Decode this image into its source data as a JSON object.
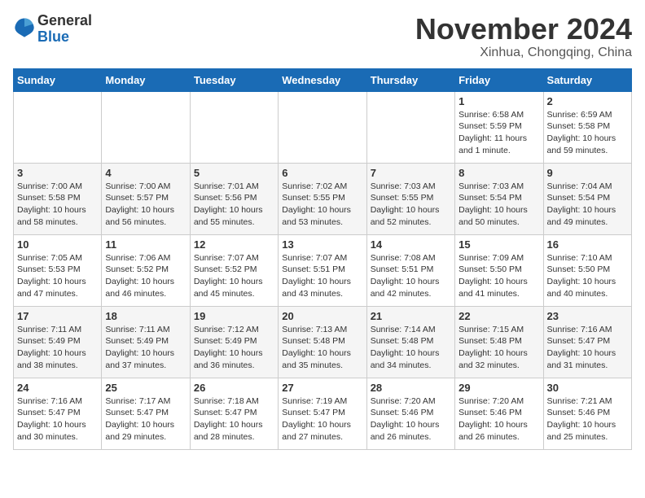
{
  "header": {
    "logo_line1": "General",
    "logo_line2": "Blue",
    "month_title": "November 2024",
    "location": "Xinhua, Chongqing, China"
  },
  "days_of_week": [
    "Sunday",
    "Monday",
    "Tuesday",
    "Wednesday",
    "Thursday",
    "Friday",
    "Saturday"
  ],
  "weeks": [
    [
      {
        "day": "",
        "info": ""
      },
      {
        "day": "",
        "info": ""
      },
      {
        "day": "",
        "info": ""
      },
      {
        "day": "",
        "info": ""
      },
      {
        "day": "",
        "info": ""
      },
      {
        "day": "1",
        "info": "Sunrise: 6:58 AM\nSunset: 5:59 PM\nDaylight: 11 hours and 1 minute."
      },
      {
        "day": "2",
        "info": "Sunrise: 6:59 AM\nSunset: 5:58 PM\nDaylight: 10 hours and 59 minutes."
      }
    ],
    [
      {
        "day": "3",
        "info": "Sunrise: 7:00 AM\nSunset: 5:58 PM\nDaylight: 10 hours and 58 minutes."
      },
      {
        "day": "4",
        "info": "Sunrise: 7:00 AM\nSunset: 5:57 PM\nDaylight: 10 hours and 56 minutes."
      },
      {
        "day": "5",
        "info": "Sunrise: 7:01 AM\nSunset: 5:56 PM\nDaylight: 10 hours and 55 minutes."
      },
      {
        "day": "6",
        "info": "Sunrise: 7:02 AM\nSunset: 5:55 PM\nDaylight: 10 hours and 53 minutes."
      },
      {
        "day": "7",
        "info": "Sunrise: 7:03 AM\nSunset: 5:55 PM\nDaylight: 10 hours and 52 minutes."
      },
      {
        "day": "8",
        "info": "Sunrise: 7:03 AM\nSunset: 5:54 PM\nDaylight: 10 hours and 50 minutes."
      },
      {
        "day": "9",
        "info": "Sunrise: 7:04 AM\nSunset: 5:54 PM\nDaylight: 10 hours and 49 minutes."
      }
    ],
    [
      {
        "day": "10",
        "info": "Sunrise: 7:05 AM\nSunset: 5:53 PM\nDaylight: 10 hours and 47 minutes."
      },
      {
        "day": "11",
        "info": "Sunrise: 7:06 AM\nSunset: 5:52 PM\nDaylight: 10 hours and 46 minutes."
      },
      {
        "day": "12",
        "info": "Sunrise: 7:07 AM\nSunset: 5:52 PM\nDaylight: 10 hours and 45 minutes."
      },
      {
        "day": "13",
        "info": "Sunrise: 7:07 AM\nSunset: 5:51 PM\nDaylight: 10 hours and 43 minutes."
      },
      {
        "day": "14",
        "info": "Sunrise: 7:08 AM\nSunset: 5:51 PM\nDaylight: 10 hours and 42 minutes."
      },
      {
        "day": "15",
        "info": "Sunrise: 7:09 AM\nSunset: 5:50 PM\nDaylight: 10 hours and 41 minutes."
      },
      {
        "day": "16",
        "info": "Sunrise: 7:10 AM\nSunset: 5:50 PM\nDaylight: 10 hours and 40 minutes."
      }
    ],
    [
      {
        "day": "17",
        "info": "Sunrise: 7:11 AM\nSunset: 5:49 PM\nDaylight: 10 hours and 38 minutes."
      },
      {
        "day": "18",
        "info": "Sunrise: 7:11 AM\nSunset: 5:49 PM\nDaylight: 10 hours and 37 minutes."
      },
      {
        "day": "19",
        "info": "Sunrise: 7:12 AM\nSunset: 5:49 PM\nDaylight: 10 hours and 36 minutes."
      },
      {
        "day": "20",
        "info": "Sunrise: 7:13 AM\nSunset: 5:48 PM\nDaylight: 10 hours and 35 minutes."
      },
      {
        "day": "21",
        "info": "Sunrise: 7:14 AM\nSunset: 5:48 PM\nDaylight: 10 hours and 34 minutes."
      },
      {
        "day": "22",
        "info": "Sunrise: 7:15 AM\nSunset: 5:48 PM\nDaylight: 10 hours and 32 minutes."
      },
      {
        "day": "23",
        "info": "Sunrise: 7:16 AM\nSunset: 5:47 PM\nDaylight: 10 hours and 31 minutes."
      }
    ],
    [
      {
        "day": "24",
        "info": "Sunrise: 7:16 AM\nSunset: 5:47 PM\nDaylight: 10 hours and 30 minutes."
      },
      {
        "day": "25",
        "info": "Sunrise: 7:17 AM\nSunset: 5:47 PM\nDaylight: 10 hours and 29 minutes."
      },
      {
        "day": "26",
        "info": "Sunrise: 7:18 AM\nSunset: 5:47 PM\nDaylight: 10 hours and 28 minutes."
      },
      {
        "day": "27",
        "info": "Sunrise: 7:19 AM\nSunset: 5:47 PM\nDaylight: 10 hours and 27 minutes."
      },
      {
        "day": "28",
        "info": "Sunrise: 7:20 AM\nSunset: 5:46 PM\nDaylight: 10 hours and 26 minutes."
      },
      {
        "day": "29",
        "info": "Sunrise: 7:20 AM\nSunset: 5:46 PM\nDaylight: 10 hours and 26 minutes."
      },
      {
        "day": "30",
        "info": "Sunrise: 7:21 AM\nSunset: 5:46 PM\nDaylight: 10 hours and 25 minutes."
      }
    ]
  ]
}
